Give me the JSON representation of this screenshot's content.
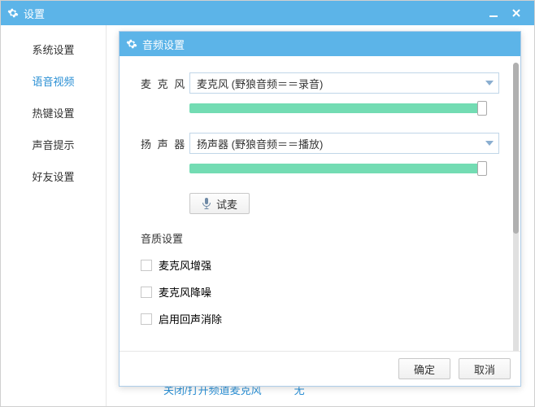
{
  "window": {
    "title": "设置"
  },
  "sidebar": {
    "items": [
      {
        "label": "系统设置"
      },
      {
        "label": "语音视频"
      },
      {
        "label": "热键设置"
      },
      {
        "label": "声音提示"
      },
      {
        "label": "好友设置"
      }
    ]
  },
  "background": {
    "line1": "关闭/打开频道麦克风",
    "line2": "无"
  },
  "dialog": {
    "title": "音频设置",
    "mic_label": "麦 克 风",
    "mic_value": "麦克风 (野狼音频＝＝录音)",
    "speaker_label": "扬 声 器",
    "speaker_value": "扬声器 (野狼音频＝＝播放)",
    "test_label": "试麦",
    "quality_title": "音质设置",
    "checkboxes": [
      {
        "label": "麦克风增强"
      },
      {
        "label": "麦克风降噪"
      },
      {
        "label": "启用回声消除"
      }
    ],
    "ok": "确定",
    "cancel": "取消"
  }
}
